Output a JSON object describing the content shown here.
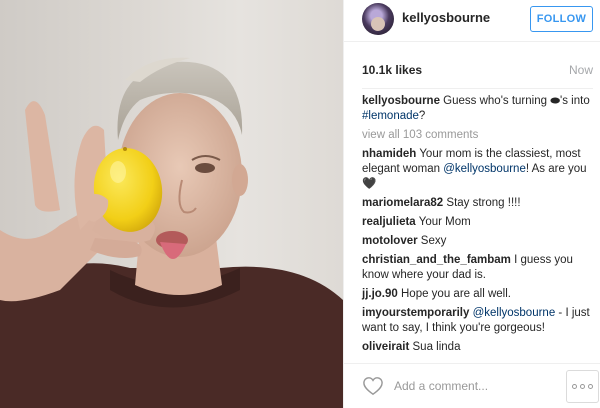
{
  "post": {
    "username": "kellyosbourne",
    "follow_label": "FOLLOW",
    "likes": "10.1k likes",
    "time": "Now"
  },
  "caption": {
    "user": "kellyosbourne",
    "text_before": "Guess who's turning ",
    "emoji": "⬬",
    "text_mid": "'s into ",
    "hashtag": "#lemonade",
    "text_after": "?"
  },
  "view_all": "view all 103 comments",
  "comments": [
    {
      "user": "nhamideh",
      "text": "Your mom is the classiest, most elegant woman ",
      "mention": "@kellyosbourne",
      "after": "! As are you 🖤"
    },
    {
      "user": "mariomelara82",
      "text": "Stay strong !!!!"
    },
    {
      "user": "realjulieta",
      "text": "Your Mom"
    },
    {
      "user": "motolover",
      "text": "Sexy"
    },
    {
      "user": "christian_and_the_fambam",
      "text": "I guess you know where your dad is."
    },
    {
      "user": "jj.jo.90",
      "text": "Hope you are all well."
    },
    {
      "user": "imyourstemporarily",
      "text": "",
      "mention": "@kellyosbourne",
      "after": " - I just want to say, I think you're gorgeous!"
    },
    {
      "user": "oliveirait",
      "text": "Sua linda"
    }
  ],
  "footer": {
    "add_comment_placeholder": "Add a comment...",
    "heart_icon": "heart-outline-icon",
    "more_icon": "more-options-icon"
  },
  "colors": {
    "accent": "#3897f0",
    "mention": "#003569",
    "muted": "#999999",
    "border": "#efefef",
    "lemon": "#f4d21c",
    "sweater": "#4a2a26"
  }
}
